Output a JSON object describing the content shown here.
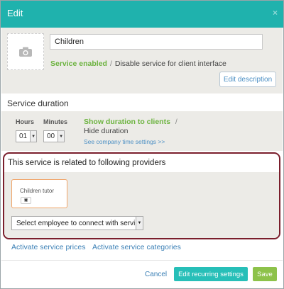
{
  "dialog": {
    "title": "Edit",
    "close_symbol": "×"
  },
  "service": {
    "name": "Children",
    "photo_icon": "camera-icon",
    "enabled_label": "Service enabled",
    "separator": "/",
    "disable_label": "Disable service for client interface",
    "edit_description_label": "Edit description"
  },
  "duration": {
    "title": "Service duration",
    "hours_label": "Hours",
    "hours_value": "01",
    "minutes_label": "Minutes",
    "minutes_value": "00",
    "show_label": "Show duration to clients",
    "separator": "/",
    "hide_label": "Hide duration",
    "company_settings_link": "See company time settings >>"
  },
  "providers": {
    "title": "This service is related to following providers",
    "items": [
      {
        "name": "Children tutor",
        "remove_symbol": "✖"
      }
    ],
    "select_placeholder": "Select employee to connect with servi"
  },
  "links": {
    "prices": "Activate service prices",
    "categories": "Activate service categories"
  },
  "footer": {
    "cancel_label": "Cancel",
    "recurring_label": "Edit recurring settings",
    "save_label": "Save"
  },
  "colors": {
    "header_bg": "#1fb2ad",
    "enabled_green": "#6cb33f",
    "highlight_border": "#7a1e2c",
    "save_green": "#8dc24a",
    "recurring_teal": "#27bfb8"
  }
}
